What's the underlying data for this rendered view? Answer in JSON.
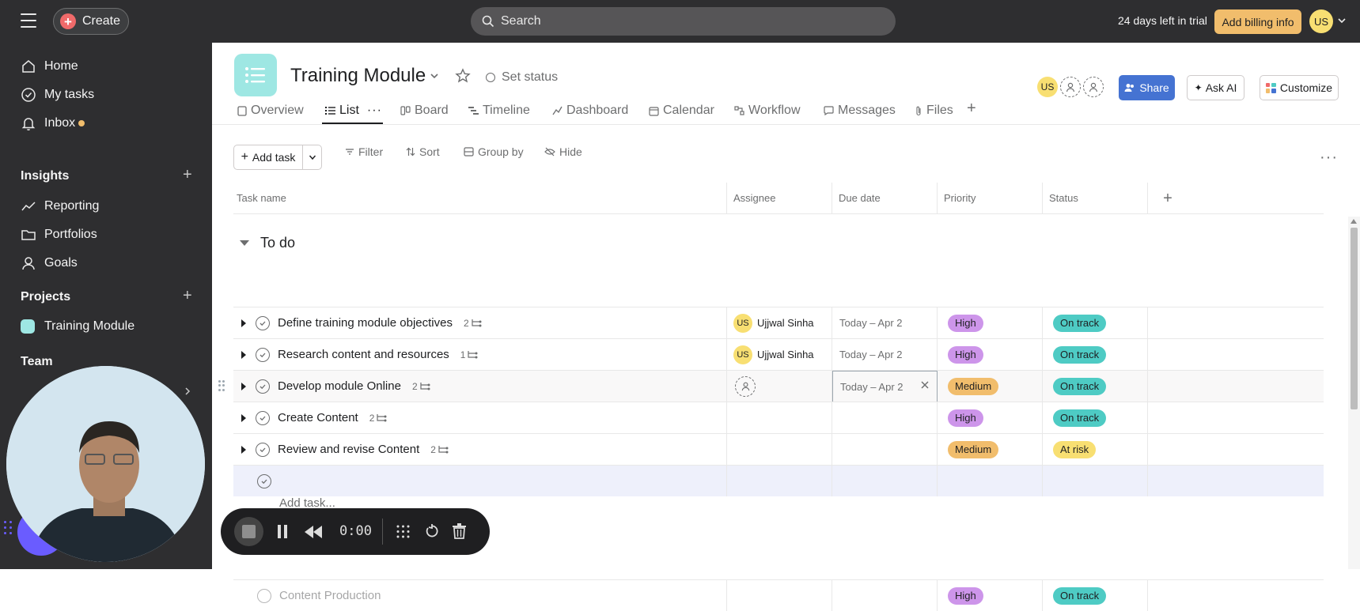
{
  "topbar": {
    "create_label": "Create",
    "search_placeholder": "Search",
    "trial_text": "24 days left in trial",
    "billing_label": "Add billing info",
    "user_initials": "US"
  },
  "sidebar": {
    "nav": [
      {
        "label": "Home",
        "icon": "home-icon"
      },
      {
        "label": "My tasks",
        "icon": "check-circle-icon"
      },
      {
        "label": "Inbox",
        "icon": "bell-icon"
      }
    ],
    "insights_title": "Insights",
    "insights": [
      {
        "label": "Reporting",
        "icon": "chart-line-icon"
      },
      {
        "label": "Portfolios",
        "icon": "folder-icon"
      },
      {
        "label": "Goals",
        "icon": "person-icon"
      }
    ],
    "projects_title": "Projects",
    "projects": [
      {
        "label": "Training Module",
        "color": "#9ee7e3"
      }
    ],
    "team_title": "Team"
  },
  "project": {
    "title": "Training Module",
    "set_status": "Set status",
    "member_initials": "US",
    "share_label": "Share",
    "ask_ai_label": "Ask AI",
    "customize_label": "Customize"
  },
  "tabs": [
    "Overview",
    "List",
    "Board",
    "Timeline",
    "Dashboard",
    "Calendar",
    "Workflow",
    "Messages",
    "Files"
  ],
  "toolbar": {
    "add_task": "Add task",
    "filter": "Filter",
    "sort": "Sort",
    "group_by": "Group by",
    "hide": "Hide"
  },
  "table": {
    "columns": [
      "Task name",
      "Assignee",
      "Due date",
      "Priority",
      "Status"
    ],
    "section": "To do",
    "rows": [
      {
        "name": "Define training module objectives",
        "subtasks": "2",
        "assignee_initials": "US",
        "assignee": "Ujjwal Sinha",
        "due": "Today – Apr 2",
        "priority": "High",
        "status": "On track"
      },
      {
        "name": "Research content and resources",
        "subtasks": "1",
        "assignee_initials": "US",
        "assignee": "Ujjwal Sinha",
        "due": "Today – Apr 2",
        "priority": "High",
        "status": "On track"
      },
      {
        "name": "Develop module Online",
        "subtasks": "2",
        "assignee_initials": "",
        "assignee": "",
        "due": "Today – Apr 2",
        "priority": "Medium",
        "status": "On track"
      },
      {
        "name": "Create Content",
        "subtasks": "2",
        "assignee_initials": "",
        "assignee": "",
        "due": "",
        "priority": "High",
        "status": "On track"
      },
      {
        "name": "Review and revise Content",
        "subtasks": "2",
        "assignee_initials": "",
        "assignee": "",
        "due": "",
        "priority": "Medium",
        "status": "At risk"
      }
    ],
    "add_task_link": "Add task...",
    "lower_row": {
      "name": "Content Production",
      "priority": "High",
      "status": "On track"
    }
  },
  "recorder": {
    "time": "0:00"
  },
  "colors": {
    "accent": "#4573d2",
    "high": "#cd95ea",
    "medium": "#f1bd6c",
    "on_track": "#4ecbc4",
    "at_risk": "#f8df72"
  }
}
